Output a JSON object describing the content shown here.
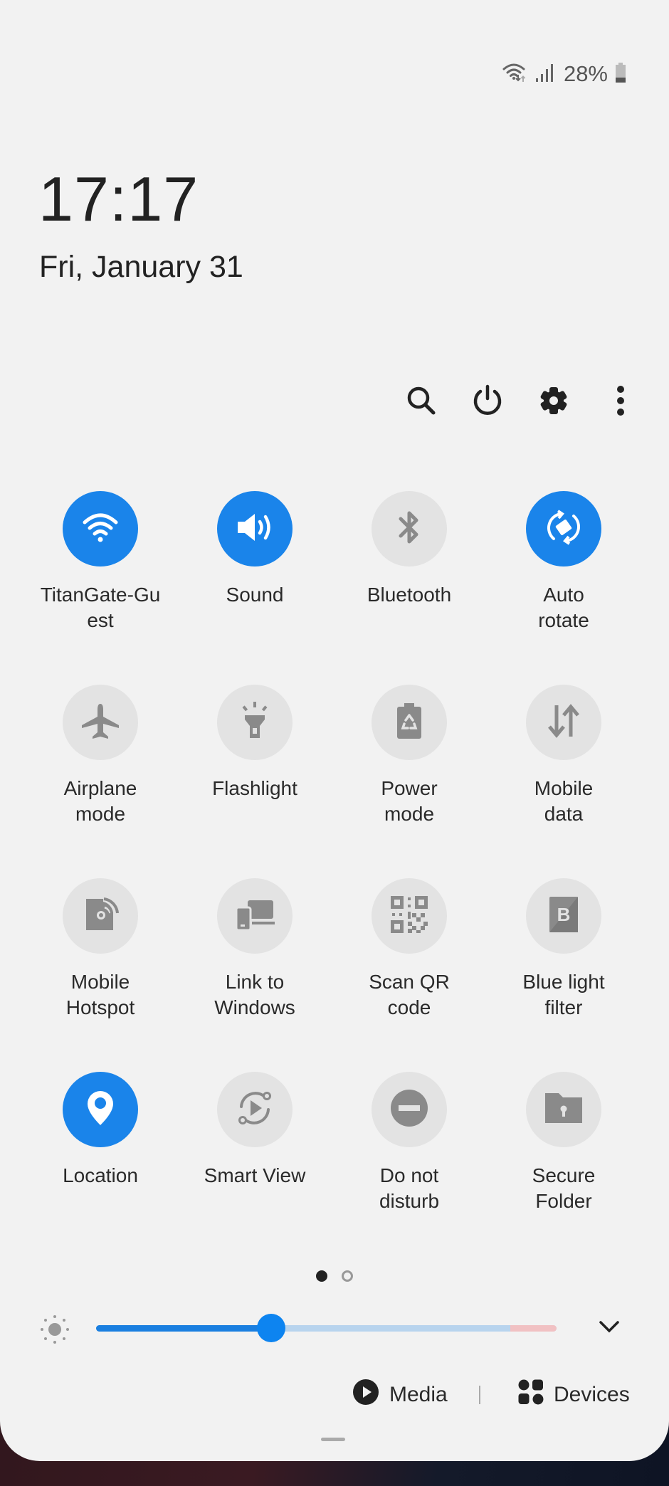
{
  "status_bar": {
    "wifi_icon": "wifi-with-data-arrows",
    "signal_icon": "cellular-signal",
    "battery_percent": "28%",
    "battery_icon": "battery",
    "battery_level": 0.28
  },
  "clock": {
    "time": "17:17",
    "date": "Fri, January 31"
  },
  "toolbar": {
    "search_icon": "search-icon",
    "power_icon": "power-icon",
    "settings_icon": "gear-icon",
    "more_icon": "more-vertical-icon"
  },
  "colors": {
    "accent": "#1a84ea",
    "tile_off": "#e3e3e3",
    "icon_off": "#8a8a8a",
    "panel": "#f2f2f2"
  },
  "tiles": [
    {
      "label": "TitanGate-Gu\nest",
      "icon": "wifi",
      "on": true
    },
    {
      "label": "Sound",
      "icon": "sound",
      "on": true
    },
    {
      "label": "Bluetooth",
      "icon": "bluetooth",
      "on": false
    },
    {
      "label": "Auto\nrotate",
      "icon": "auto-rotate",
      "on": true
    },
    {
      "label": "Airplane\nmode",
      "icon": "airplane",
      "on": false
    },
    {
      "label": "Flashlight",
      "icon": "flashlight",
      "on": false
    },
    {
      "label": "Power\nmode",
      "icon": "power-mode",
      "on": false
    },
    {
      "label": "Mobile\ndata",
      "icon": "mobile-data",
      "on": false
    },
    {
      "label": "Mobile\nHotspot",
      "icon": "hotspot",
      "on": false
    },
    {
      "label": "Link to\nWindows",
      "icon": "link-to-windows",
      "on": false
    },
    {
      "label": "Scan QR\ncode",
      "icon": "qr-code",
      "on": false
    },
    {
      "label": "Blue light\nfilter",
      "icon": "blue-light-filter",
      "on": false
    },
    {
      "label": "Location",
      "icon": "location",
      "on": true
    },
    {
      "label": "Smart View",
      "icon": "smart-view",
      "on": false
    },
    {
      "label": "Do not\ndisturb",
      "icon": "do-not-disturb",
      "on": false
    },
    {
      "label": "Secure\nFolder",
      "icon": "secure-folder",
      "on": false
    }
  ],
  "pager": {
    "pages": 2,
    "current": 1
  },
  "brightness": {
    "value_fraction": 0.38,
    "icon": "sun-icon",
    "expand_icon": "chevron-down-icon"
  },
  "bottom_bar": {
    "media_label": "Media",
    "devices_label": "Devices"
  }
}
